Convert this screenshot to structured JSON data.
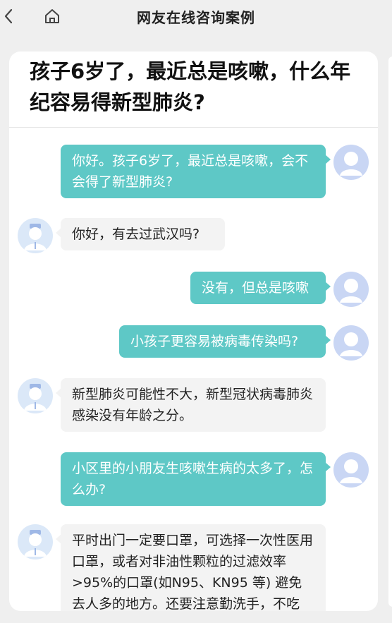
{
  "header": {
    "title": "网友在线咨询案例",
    "back_icon": "chevron-left-icon",
    "home_icon": "home-icon"
  },
  "question": {
    "text": "孩子6岁了，最近总是咳嗽，什么年纪容易得新型肺炎?"
  },
  "messages": [
    {
      "role": "user",
      "text": "你好。孩子6岁了，最近总是咳嗽，会不会得了新型肺炎?"
    },
    {
      "role": "doctor",
      "text": "你好，有去过武汉吗?"
    },
    {
      "role": "user",
      "text": "没有，但总是咳嗽"
    },
    {
      "role": "user",
      "text": "小孩子更容易被病毒传染吗?"
    },
    {
      "role": "doctor",
      "text": "新型肺炎可能性不大，新型冠状病毒肺炎感染没有年龄之分。"
    },
    {
      "role": "user",
      "text": "小区里的小朋友生咳嗽生病的太多了，怎么办?"
    },
    {
      "role": "doctor",
      "text": "平时出门一定要口罩，可选择一次性医用口罩，或者对非油性颗粒的过滤效率>95%的口罩(如N95、KN95 等) 避免去人多的地方。还要注意勤洗手，不吃"
    }
  ],
  "colors": {
    "user_bubble": "#5ec8c6",
    "doctor_bubble": "#f3f3f3",
    "background": "#efefef"
  }
}
